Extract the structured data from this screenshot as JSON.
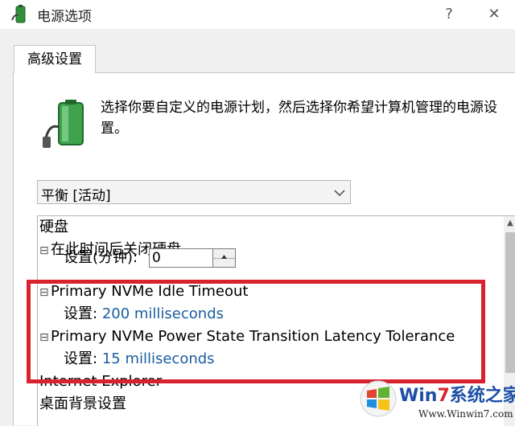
{
  "window": {
    "title": "电源选项",
    "help_label": "?",
    "close_label": "✕"
  },
  "tab": {
    "label": "高级设置"
  },
  "description": "选择你要自定义的电源计划，然后选择你希望计算机管理的电源设置。",
  "plan_select": {
    "selected": "平衡 [活动]"
  },
  "tree": {
    "hdd": {
      "label": "硬盘"
    },
    "hdd_off": {
      "expander": "⊟",
      "label": "在此时间后关闭硬盘"
    },
    "hdd_setting": {
      "label": "设置(分钟):",
      "value": "0"
    },
    "nvme_idle": {
      "expander": "⊟",
      "label": "Primary NVMe Idle Timeout"
    },
    "nvme_idle_setting": {
      "label": "设置:",
      "value": "200 milliseconds"
    },
    "nvme_latency": {
      "expander": "⊟",
      "label": "Primary NVMe Power State Transition Latency Tolerance"
    },
    "nvme_latency_setting": {
      "label": "设置:",
      "value": "15 milliseconds"
    },
    "ie": {
      "label": "Internet Explorer"
    },
    "desktop_bg": {
      "label": "桌面背景设置"
    }
  },
  "scroll_up_icon": "▲",
  "watermark": {
    "brand_prefix": "Win",
    "brand_num": "7",
    "brand_suffix": "系统之家",
    "url": "Www.Winwin7.com"
  },
  "colors": {
    "highlight": "#d8232f",
    "setting_value": "#1a5ea0"
  }
}
